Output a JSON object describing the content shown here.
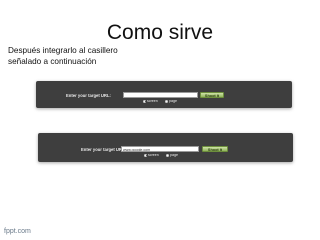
{
  "slide": {
    "title": "Como sirve",
    "body_lines": [
      "Después integrarlo al casillero",
      "señalado a continuación"
    ],
    "footer": "fppt.com"
  },
  "panels": [
    {
      "url_label": "Enter your target URL:",
      "url_value": "",
      "button_label": "Shoot It",
      "option_a": "screen",
      "option_b": "page",
      "selected_option": "screen"
    },
    {
      "url_label": "Enter your target URL:",
      "url_value": "www.google.com",
      "button_label": "Shoot It",
      "option_a": "screen",
      "option_b": "page",
      "selected_option": "screen"
    }
  ],
  "colors": {
    "panel_background": "#3e3e3e",
    "button_green": "#8fb35a",
    "footer_text": "#6a7a8a"
  }
}
